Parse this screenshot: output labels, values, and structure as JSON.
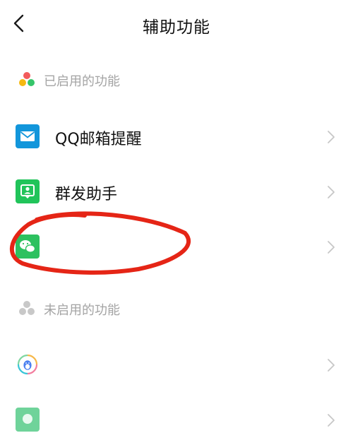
{
  "header": {
    "title": "辅助功能",
    "back_icon": "chevron-left-icon"
  },
  "enabled_section": {
    "label": "已启用的功能",
    "icon": "colored-dots-icon",
    "items": [
      {
        "label": "QQ邮箱提醒",
        "icon": "mail-icon",
        "icon_color": "#1296db"
      },
      {
        "label": "群发助手",
        "icon": "group-send-icon",
        "icon_color": "#21c45a"
      },
      {
        "label": "",
        "icon": "wechat-icon",
        "icon_color": "#2dc15f"
      }
    ]
  },
  "disabled_section": {
    "label": "未启用的功能",
    "icon": "gray-dots-icon",
    "items": [
      {
        "label": "",
        "icon": "qq-penguin-icon"
      },
      {
        "label": "",
        "icon": "green-app-icon",
        "icon_color": "#6fd39a"
      }
    ]
  },
  "colors": {
    "annotation_stroke": "#e52516",
    "chevron": "#c7c7c7",
    "section_label": "#a4a4a4"
  }
}
